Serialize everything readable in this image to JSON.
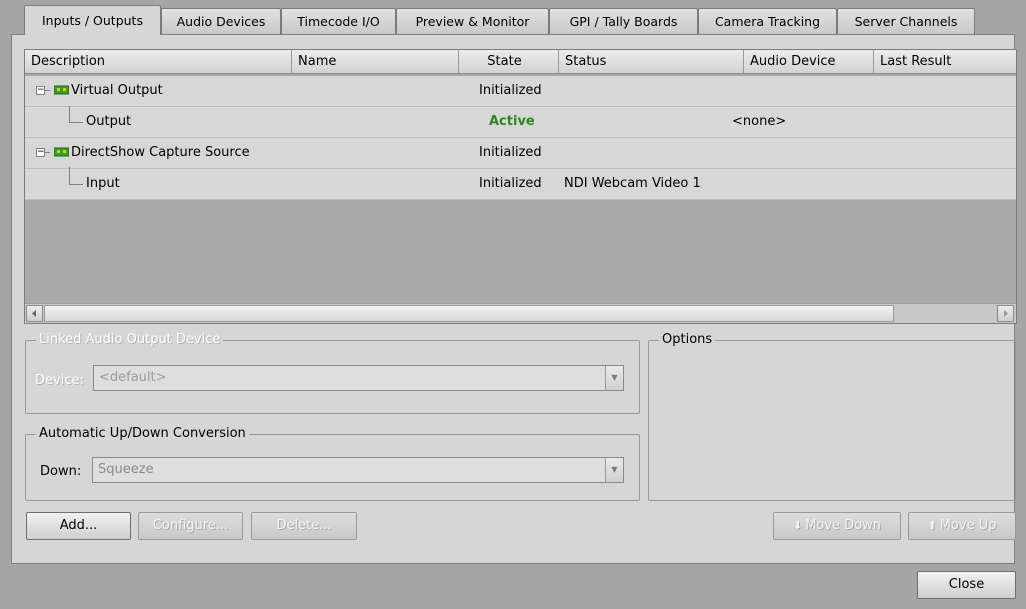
{
  "tabs": [
    {
      "label": "Inputs / Outputs",
      "active": true
    },
    {
      "label": "Audio Devices"
    },
    {
      "label": "Timecode I/O"
    },
    {
      "label": "Preview & Monitor"
    },
    {
      "label": "GPI / Tally Boards"
    },
    {
      "label": "Camera Tracking"
    },
    {
      "label": "Server Channels"
    }
  ],
  "table": {
    "columns": [
      "Description",
      "Name",
      "State",
      "Status",
      "Audio Device",
      "Last Result"
    ],
    "rows": [
      {
        "description": "Virtual Output",
        "name": "",
        "state": "Initialized",
        "status": "",
        "audio_device": "",
        "last_result": "",
        "level": 0,
        "icon": "device-card-icon"
      },
      {
        "description": "Output",
        "name": "",
        "state": "Active",
        "status": "",
        "audio_device": "<none>",
        "last_result": "",
        "level": 1
      },
      {
        "description": "DirectShow Capture Source",
        "name": "",
        "state": "Initialized",
        "status": "",
        "audio_device": "",
        "last_result": "",
        "level": 0,
        "icon": "device-card-icon"
      },
      {
        "description": "Input",
        "name": "",
        "state": "Initialized",
        "status": "NDI Webcam Video 1",
        "audio_device": "",
        "last_result": "",
        "level": 1
      }
    ]
  },
  "linked_audio": {
    "title": "Linked Audio Output Device",
    "device_label": "Device:",
    "device_value": "<default>"
  },
  "conversion": {
    "title": "Automatic Up/Down Conversion",
    "down_label": "Down:",
    "down_value": "Squeeze"
  },
  "options": {
    "title": "Options"
  },
  "buttons": {
    "add": "Add...",
    "configure": "Configure...",
    "delete": "Delete...",
    "move_down": "Move Down",
    "move_up": "Move Up",
    "close": "Close"
  },
  "colors": {
    "active_state": "#2b8a1e"
  }
}
